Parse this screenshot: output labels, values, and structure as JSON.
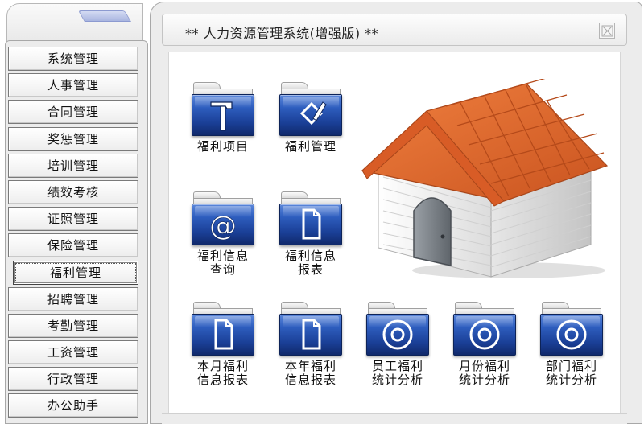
{
  "window": {
    "title": "** 人力资源管理系统(增强版) **"
  },
  "sidebar": {
    "items": [
      {
        "label": "系统管理",
        "active": false
      },
      {
        "label": "人事管理",
        "active": false
      },
      {
        "label": "合同管理",
        "active": false
      },
      {
        "label": "奖惩管理",
        "active": false
      },
      {
        "label": "培训管理",
        "active": false
      },
      {
        "label": "绩效考核",
        "active": false
      },
      {
        "label": "证照管理",
        "active": false
      },
      {
        "label": "保险管理",
        "active": false
      },
      {
        "label": "福利管理",
        "active": true
      },
      {
        "label": "招聘管理",
        "active": false
      },
      {
        "label": "考勤管理",
        "active": false
      },
      {
        "label": "工资管理",
        "active": false
      },
      {
        "label": "行政管理",
        "active": false
      },
      {
        "label": "办公助手",
        "active": false
      }
    ]
  },
  "tiles": [
    {
      "icon": "hammer-icon",
      "line1": "福利项目",
      "line2": ""
    },
    {
      "icon": "edit-pencil-icon",
      "line1": "福利管理",
      "line2": ""
    },
    {
      "icon": "at-sign-icon",
      "line1": "福利信息",
      "line2": "查询"
    },
    {
      "icon": "document-icon",
      "line1": "福利信息",
      "line2": "报表"
    },
    {
      "icon": "document-icon",
      "line1": "本月福利",
      "line2": "信息报表"
    },
    {
      "icon": "document-icon",
      "line1": "本年福利",
      "line2": "信息报表"
    },
    {
      "icon": "disc-icon",
      "line1": "员工福利",
      "line2": "统计分析"
    },
    {
      "icon": "disc-icon",
      "line1": "月份福利",
      "line2": "统计分析"
    },
    {
      "icon": "disc-icon",
      "line1": "部门福利",
      "line2": "统计分析"
    }
  ],
  "colors": {
    "folder_blue": "#1a3f96",
    "roof_orange": "#e2632a",
    "house_wall": "#f4f4f4"
  }
}
